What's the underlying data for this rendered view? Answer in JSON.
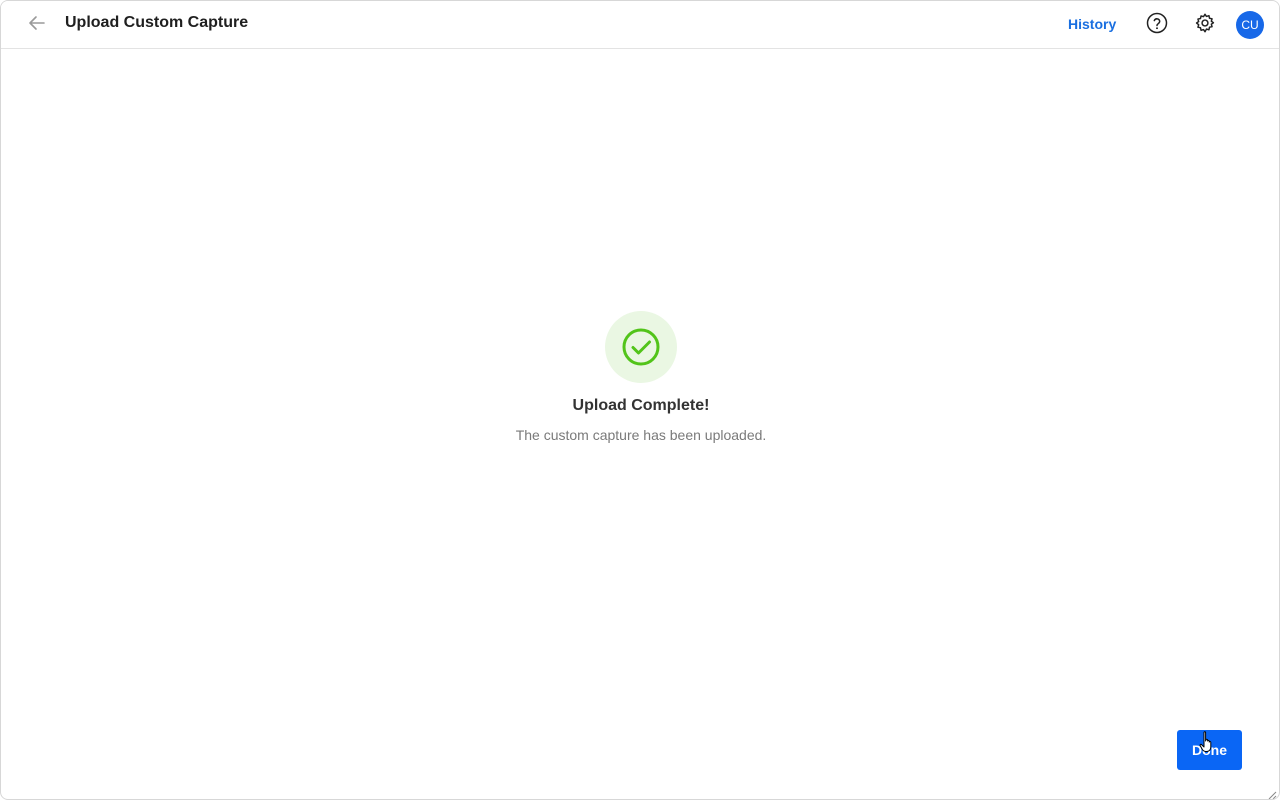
{
  "header": {
    "back_icon": "arrow-left-icon",
    "title": "Upload Custom Capture",
    "history_label": "History",
    "help_icon": "question-circle-icon",
    "settings_icon": "gear-icon",
    "avatar_initials": "CU"
  },
  "status": {
    "icon": "check-circle-icon",
    "title": "Upload Complete!",
    "message": "The custom capture has been uploaded."
  },
  "footer": {
    "done_label": "Done"
  },
  "colors": {
    "accent": "#0a66f5",
    "link": "#1a6fe0",
    "success": "#52c41a",
    "success_bg": "#eaf7e3"
  }
}
